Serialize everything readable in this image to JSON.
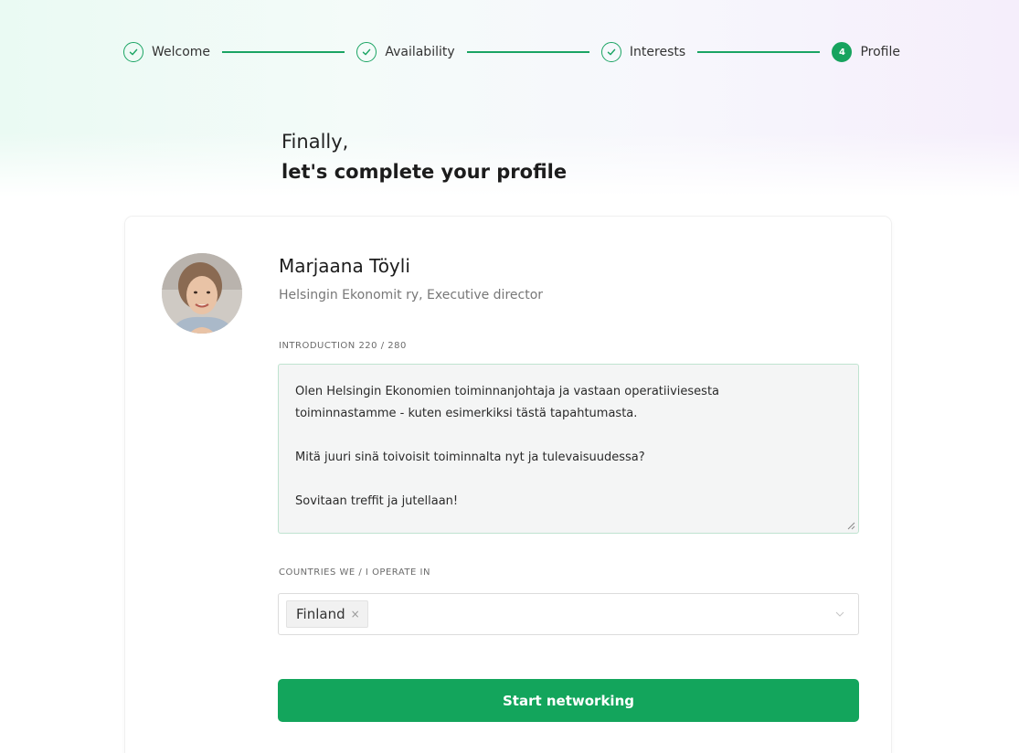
{
  "stepper": {
    "steps": [
      {
        "label": "Welcome",
        "state": "done"
      },
      {
        "label": "Availability",
        "state": "done"
      },
      {
        "label": "Interests",
        "state": "done"
      },
      {
        "label": "Profile",
        "state": "active",
        "number": "4"
      }
    ]
  },
  "heading": {
    "line1": "Finally,",
    "line2": "let's complete your profile"
  },
  "profile": {
    "name": "Marjaana Töyli",
    "subtitle": "Helsingin Ekonomit ry, Executive director",
    "avatar_icon": "avatar-photo"
  },
  "introduction": {
    "label": "INTRODUCTION 220 / 280",
    "lines": [
      "Olen Helsingin Ekonomien toiminnanjohtaja ja vastaan operatiiviesesta",
      "toiminnastamme - kuten esimerkiksi tästä tapahtumasta.",
      "",
      "Mitä juuri sinä toivoisit toiminnalta nyt ja tulevaisuudessa?",
      "",
      "Sovitaan treffit ja jutellaan!"
    ]
  },
  "countries": {
    "label": "COUNTRIES WE / I OPERATE IN",
    "selected": [
      "Finland"
    ],
    "remove_glyph": "×"
  },
  "cta": {
    "label": "Start networking"
  },
  "colors": {
    "accent": "#13a55c",
    "step_line": "#1aa463"
  }
}
